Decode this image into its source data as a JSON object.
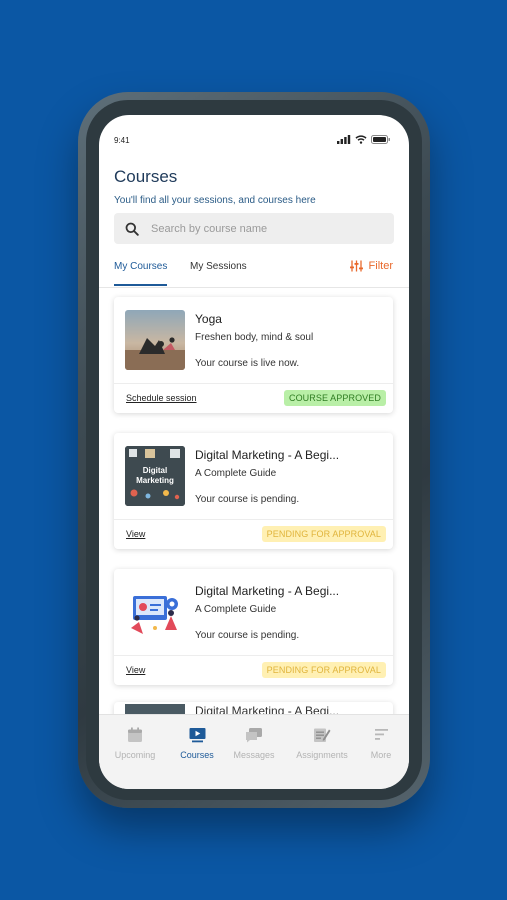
{
  "status_bar": {
    "time": "9:41"
  },
  "header": {
    "title": "Courses",
    "subtitle": "You'll find all your sessions, and courses here"
  },
  "search": {
    "placeholder": "Search by course name",
    "value": ""
  },
  "tabs": [
    {
      "label": "My Courses",
      "active": true
    },
    {
      "label": "My Sessions",
      "active": false
    }
  ],
  "filter": {
    "label": "Filter"
  },
  "courses": [
    {
      "title": "Yoga",
      "subtitle": "Freshen body, mind & soul",
      "status": "Your course is live now.",
      "action": "Schedule session",
      "badge": "COURSE APPROVED",
      "badge_type": "approved"
    },
    {
      "title": "Digital Marketing - A Begi...",
      "subtitle": "A Complete Guide",
      "status": "Your course is pending.",
      "action": "View",
      "badge": "PENDING FOR APPROVAL",
      "badge_type": "pending",
      "thumb_text": "Digital Marketing"
    },
    {
      "title": "Digital Marketing - A Begi...",
      "subtitle": "A Complete Guide",
      "status": "Your course is pending.",
      "action": "View",
      "badge": "PENDING FOR APPROVAL",
      "badge_type": "pending"
    },
    {
      "title": "Digital Marketing - A Begi..."
    }
  ],
  "bottom_nav": [
    {
      "label": "Upcoming",
      "icon": "calendar-icon",
      "active": false
    },
    {
      "label": "Courses",
      "icon": "play-screen-icon",
      "active": true
    },
    {
      "label": "Messages",
      "icon": "chat-icon",
      "active": false
    },
    {
      "label": "Assignments",
      "icon": "edit-document-icon",
      "active": false
    },
    {
      "label": "More",
      "icon": "menu-lines-icon",
      "active": false
    }
  ],
  "colors": {
    "background": "#0b57a4",
    "primary": "#1e5a98",
    "filter_accent": "#e8692c",
    "approved_bg": "#b9efa7",
    "approved_text": "#2f7d22",
    "pending_bg": "#fff0b3",
    "pending_text": "#e0b43c"
  }
}
